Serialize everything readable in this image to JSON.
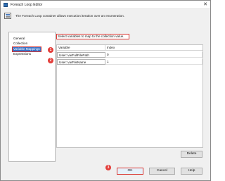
{
  "window": {
    "title": "Foreach Loop Editor",
    "close_glyph": "✕"
  },
  "description": "The Foreach Loop container allows execution iteration over an enumeration.",
  "nav": {
    "items": [
      {
        "label": "General",
        "selected": false
      },
      {
        "label": "Collection",
        "selected": false
      },
      {
        "label": "Variable Mappings",
        "selected": true
      },
      {
        "label": "Expressions",
        "selected": false
      }
    ]
  },
  "section_header": "Select variables to map to the collection value.",
  "grid": {
    "columns": [
      "Variable",
      "Index"
    ],
    "rows": [
      {
        "variable": "User::varFullFilePath",
        "index": "0"
      },
      {
        "variable": "User::varFileName",
        "index": "1"
      }
    ]
  },
  "buttons": {
    "delete": "Delete",
    "ok": "OK",
    "cancel": "Cancel",
    "help": "Help"
  },
  "annotations": [
    "1",
    "2",
    "3"
  ],
  "colors": {
    "annotation_red": "#d9342f",
    "selection_blue": "#3a74c8"
  }
}
